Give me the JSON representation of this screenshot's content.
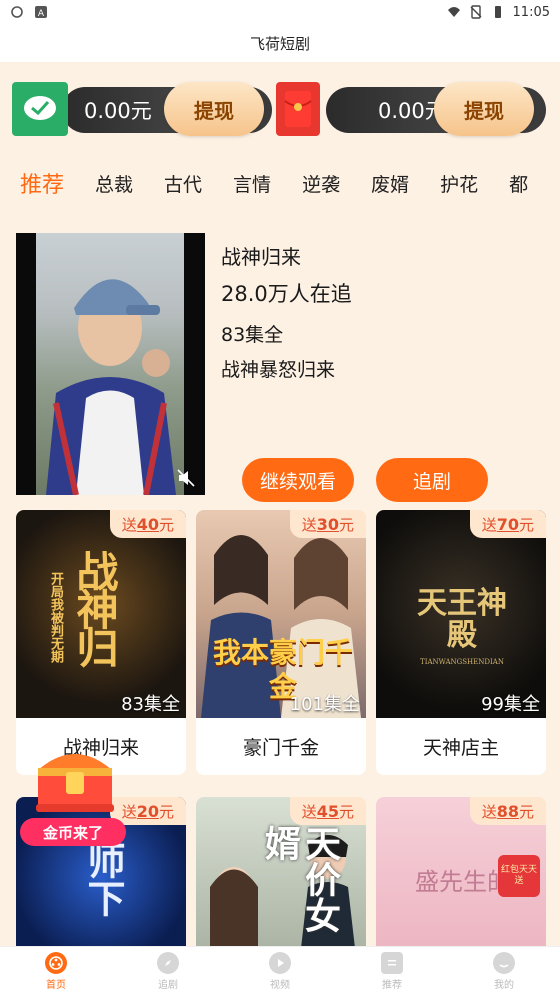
{
  "status_bar": {
    "time": "11:05"
  },
  "app": {
    "title": "飞荷短剧"
  },
  "wallet": {
    "left": {
      "amount": "0.00元",
      "button": "提现",
      "icon": "wechat-icon"
    },
    "right": {
      "amount": "0.00元",
      "button": "提现",
      "icon": "red-envelope-icon"
    }
  },
  "tabs": [
    "推荐",
    "总裁",
    "古代",
    "言情",
    "逆袭",
    "废婿",
    "护花",
    "都"
  ],
  "featured": {
    "title": "战神归来",
    "fans": "28.0万人在追",
    "episodes": "83集全",
    "description": "战神暴怒归来",
    "continue_button": "继续观看",
    "follow_button": "追剧"
  },
  "cards": [
    {
      "badge_prefix": "送",
      "badge_amount": "40",
      "badge_suffix": "元",
      "cover_text": "战神归",
      "cover_sub": "开局我被判无期",
      "eps": "83集全",
      "name": "战神归来"
    },
    {
      "badge_prefix": "送",
      "badge_amount": "30",
      "badge_suffix": "元",
      "cover_text": "我本豪门千金",
      "eps": "101集全",
      "name": "豪门千金"
    },
    {
      "badge_prefix": "送",
      "badge_amount": "70",
      "badge_suffix": "元",
      "cover_text": "天王神殿",
      "cover_sub": "TIANWANGSHENDIAN",
      "eps": "99集全",
      "name": "天神店主"
    },
    {
      "badge_prefix": "送",
      "badge_amount": "20",
      "badge_suffix": "元",
      "cover_text": "师下"
    },
    {
      "badge_prefix": "送",
      "badge_amount": "45",
      "badge_suffix": "元",
      "cover_text": "天价女婿"
    },
    {
      "badge_prefix": "送",
      "badge_amount": "88",
      "badge_suffix": "元",
      "cover_text": "盛先生的",
      "stamp": "红包天天送"
    }
  ],
  "treasure": {
    "label": "金币来了"
  },
  "bottom_nav": [
    {
      "label": "首页",
      "icon": "film-reel-icon"
    },
    {
      "label": "追剧",
      "icon": "compass-icon"
    },
    {
      "label": "视频",
      "icon": "play-icon"
    },
    {
      "label": "推荐",
      "icon": "list-icon"
    },
    {
      "label": "我的",
      "icon": "profile-icon"
    }
  ]
}
